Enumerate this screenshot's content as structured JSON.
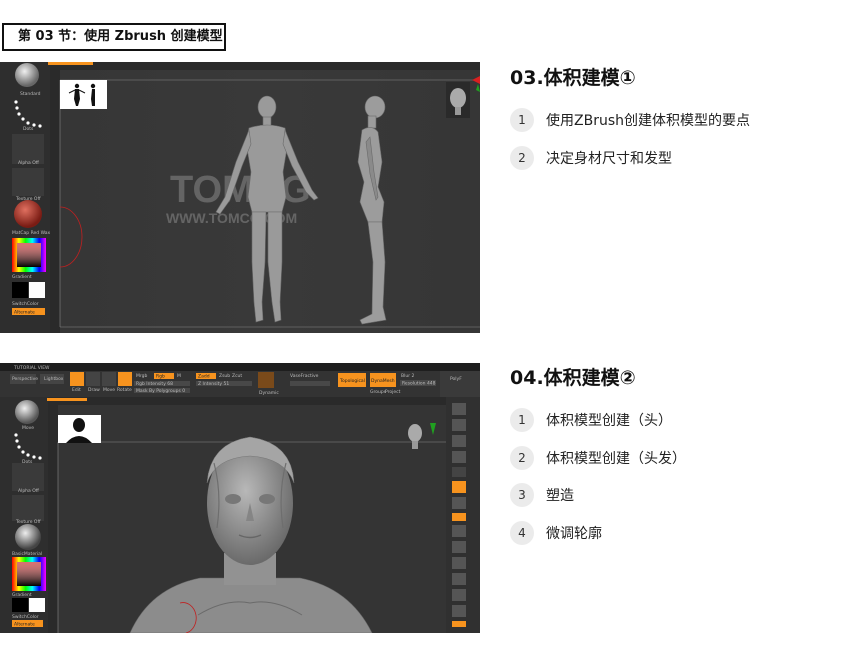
{
  "section_title": "第 03 节：使用 Zbrush 创建模型",
  "screenshot1": {
    "tool_labels": [
      "Standard",
      "Dots",
      "Alpha Off",
      "Texture Off",
      "MatCap Red Wax",
      "Gradient",
      "SwitchColor",
      "Alternate"
    ],
    "watermark": "TOMCG",
    "watermark_url": "WWW.TOMCG.COM"
  },
  "screenshot2": {
    "top_menu": "TUTORIAL VIEW",
    "top_buttons": [
      "Perspective",
      "Lightbox",
      "Edit",
      "Draw",
      "Move",
      "Scale",
      "Rotate"
    ],
    "toolbar_labels": [
      "Mrgb",
      "Rgb",
      "M",
      "Rgb Intensity 68",
      "Mask By Polygroups 0",
      "Zadd",
      "Zsub",
      "Zcut",
      "Z Intensity 51",
      "Dynamic",
      "VaseFractive",
      "Topological",
      "DynaMesh",
      "Groups",
      "Project",
      "Resolution 448",
      "Blur 2",
      "PolyF"
    ],
    "tool_labels": [
      "Move",
      "Dots",
      "Alpha Off",
      "Texture Off",
      "BasicMaterial",
      "Gradient",
      "SwitchColor",
      "Alternate"
    ]
  },
  "panel1": {
    "heading": "03.体积建模①",
    "items": [
      {
        "num": "1",
        "text": "使用ZBrush创建体积模型的要点"
      },
      {
        "num": "2",
        "text": "决定身材尺寸和发型"
      }
    ]
  },
  "panel2": {
    "heading": "04.体积建模②",
    "items": [
      {
        "num": "1",
        "text": "体积模型创建（头）"
      },
      {
        "num": "2",
        "text": "体积模型创建（头发）"
      },
      {
        "num": "3",
        "text": "塑造"
      },
      {
        "num": "4",
        "text": "微调轮廓"
      }
    ]
  },
  "colors": {
    "ui_dark": "#262626",
    "ui_panel": "#333333",
    "accent_orange": "#f7931e",
    "model_gray": "#9a9a9a"
  }
}
